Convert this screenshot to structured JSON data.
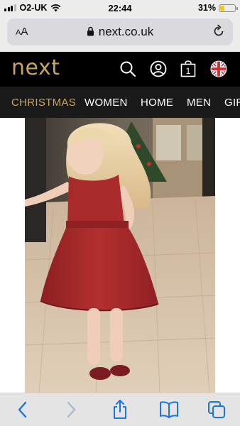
{
  "status_bar": {
    "carrier": "O2-UK",
    "time": "22:44",
    "battery_percent": "31%",
    "battery_level": 0.31,
    "battery_color": "#f2c81e",
    "icons": [
      "signal-icon",
      "wifi-icon",
      "battery-icon"
    ]
  },
  "browser": {
    "text_size_button": {
      "small": "A",
      "large": "A"
    },
    "url": "next.co.uk",
    "icons": [
      "lock-icon",
      "reload-icon"
    ]
  },
  "site_header": {
    "logo": "next",
    "logo_color": "#c9a45d",
    "icons": [
      "search-icon",
      "account-icon",
      "bag-icon",
      "uk-flag-icon"
    ],
    "bag_count": "1"
  },
  "nav": {
    "items": [
      {
        "label": "CHRISTMAS",
        "active": true
      },
      {
        "label": "WOMEN",
        "active": false
      },
      {
        "label": "HOME",
        "active": false
      },
      {
        "label": "MEN",
        "active": false
      },
      {
        "label": "GIRLS",
        "active": false
      }
    ],
    "active_color": "#c9a45d"
  },
  "product": {
    "image_icon": "product-photo-girl-red-dress"
  },
  "toolbar": {
    "icons": [
      "back-icon",
      "forward-icon",
      "share-icon",
      "bookmarks-icon",
      "tabs-icon"
    ]
  }
}
